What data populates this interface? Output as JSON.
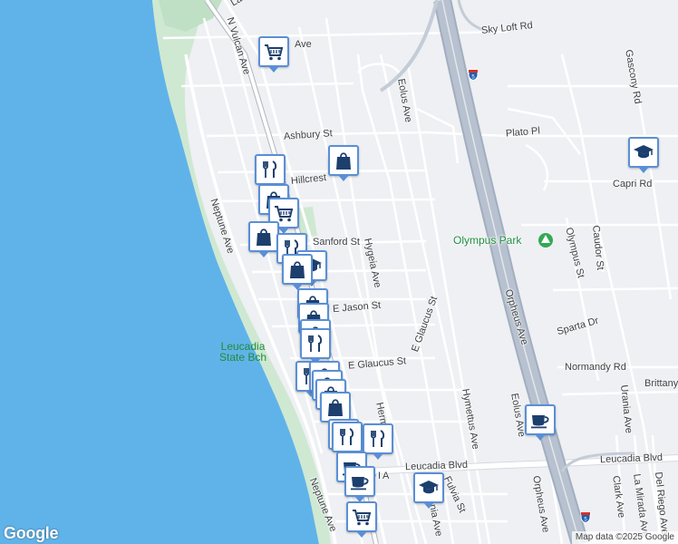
{
  "map": {
    "streets": {
      "la_costa": "La Costa",
      "n_vulcan": "N Vulcan Ave",
      "ave_top": "Ave",
      "sky_loft": "Sky Loft Rd",
      "gascony": "Gascony Rd",
      "eolus_top": "Eolus Ave",
      "ashbury": "Ashbury St",
      "plato": "Plato Pl",
      "hillcrest": "Hillcrest",
      "capri": "Capri Rd",
      "neptune_top": "Neptune Ave",
      "sanford": "Sanford St",
      "hygeia": "Hygeia Ave",
      "caudor": "Caudor St",
      "olympus": "Olympus St",
      "e_jason": "E Jason St",
      "e_glaucus_diag": "E Glaucus St",
      "orpheus_mid": "Orpheus Ave",
      "sparta": "Sparta Dr",
      "e_glaucus": "E Glaucus St",
      "normandy": "Normandy Rd",
      "brittany": "Brittany",
      "hermes": "Hermes",
      "hymettus": "Hymettus Ave",
      "eolus_bottom": "Eolus Ave",
      "urania": "Urania Ave",
      "leucadia_blvd_1": "Leucadia Blvd",
      "leucadia_blvd_2": "Leucadia Blvd",
      "fulvia": "Fulvia St",
      "urania_low": "Urania Ave",
      "orpheus_bottom": "Orpheus Ave",
      "clark": "Clark Ave",
      "la_mirada": "La Mirada Ave",
      "del_riego": "Del Riego Ave",
      "neptune_bottom": "Neptune Ave"
    },
    "district": "DIA",
    "park": "Olympus Park",
    "beach": [
      "Leucadia",
      "State Bch"
    ],
    "shields": [
      "5",
      "5"
    ],
    "logo": "Google",
    "credit": "Map data ©2025 Google"
  },
  "pins": [
    {
      "type": "shopping-cart",
      "icon": "cart"
    },
    {
      "type": "shopping-bag",
      "icon": "bag"
    },
    {
      "type": "restaurant",
      "icon": "fork-knife"
    },
    {
      "type": "shopping-bag",
      "icon": "bag"
    },
    {
      "type": "shopping-cart",
      "icon": "cart"
    },
    {
      "type": "shopping-bag",
      "icon": "bag"
    },
    {
      "type": "restaurant",
      "icon": "fork-knife"
    },
    {
      "type": "school",
      "icon": "mortarboard"
    },
    {
      "type": "shopping-bag",
      "icon": "bag"
    },
    {
      "type": "shopping-bag",
      "icon": "bag"
    },
    {
      "type": "shopping-bag",
      "icon": "bag"
    },
    {
      "type": "shopping-bag",
      "icon": "bag"
    },
    {
      "type": "restaurant",
      "icon": "fork-knife"
    },
    {
      "type": "restaurant",
      "icon": "fork-knife"
    },
    {
      "type": "shopping-bag",
      "icon": "bag"
    },
    {
      "type": "shopping-bag",
      "icon": "bag"
    },
    {
      "type": "shopping-bag",
      "icon": "bag"
    },
    {
      "type": "shopping-bag",
      "icon": "bag"
    },
    {
      "type": "restaurant",
      "icon": "fork-knife"
    },
    {
      "type": "restaurant",
      "icon": "fork-knife"
    },
    {
      "type": "restaurant",
      "icon": "fork-knife"
    },
    {
      "type": "cafe",
      "icon": "coffee-cup"
    },
    {
      "type": "school",
      "icon": "mortarboard"
    },
    {
      "type": "cafe",
      "icon": "coffee-cup"
    },
    {
      "type": "shopping-cart",
      "icon": "cart"
    },
    {
      "type": "cafe",
      "icon": "coffee-cup"
    },
    {
      "type": "school",
      "icon": "mortarboard"
    }
  ],
  "colors": {
    "water": "#60b3e8",
    "land": "#eef0f3",
    "road": "#ffffff",
    "freeway": "#a2aebf",
    "park": "#cfe8d2",
    "pin_border": "#5a8fd6",
    "icon": "#1c3f6e"
  }
}
